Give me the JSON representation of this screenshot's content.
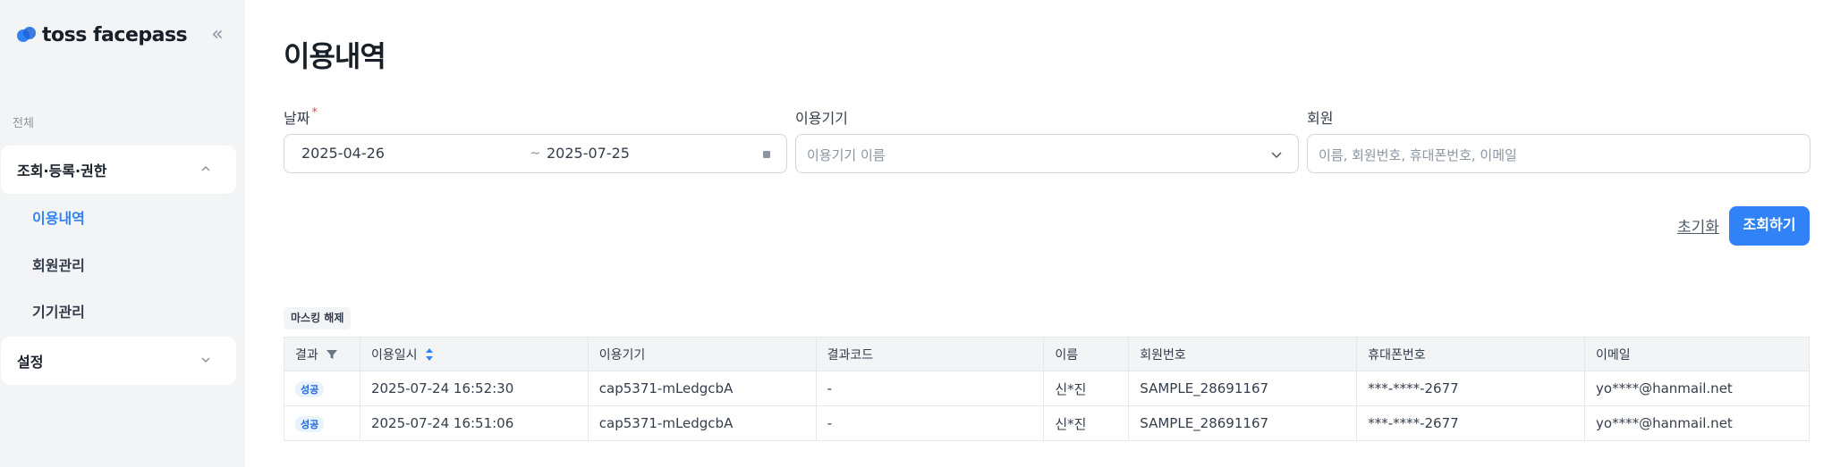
{
  "app": {
    "logo_text": "toss facepass",
    "collapse_glyph": "«"
  },
  "sidebar": {
    "section_label": "전체",
    "groups": [
      {
        "label": "조회·등록·권한",
        "expanded": true
      },
      {
        "label": "설정",
        "expanded": false
      }
    ],
    "items": [
      {
        "label": "이용내역",
        "active": true
      },
      {
        "label": "회원관리",
        "active": false
      },
      {
        "label": "기기관리",
        "active": false
      }
    ]
  },
  "page": {
    "title": "이용내역"
  },
  "filters": {
    "date": {
      "label": "날짜",
      "required_mark": "*",
      "start": "2025-04-26",
      "separator": "~",
      "end": "2025-07-25"
    },
    "device": {
      "label": "이용기기",
      "placeholder": "이용기기 이름"
    },
    "member": {
      "label": "회원",
      "placeholder": "이름, 회원번호, 휴대폰번호, 이메일"
    },
    "reset_label": "초기화",
    "search_label": "조회하기"
  },
  "table": {
    "mask_toggle_label": "마스킹 해제",
    "columns": [
      "결과",
      "이용일시",
      "이용기기",
      "결과코드",
      "이름",
      "회원번호",
      "휴대폰번호",
      "이메일"
    ],
    "rows": [
      {
        "result": "성공",
        "datetime": "2025-07-24 16:52:30",
        "device": "cap5371-mLedgcbA",
        "code": "-",
        "name": "신*진",
        "member_no": "SAMPLE_28691167",
        "phone": "***-****-2677",
        "email": "yo****@hanmail.net"
      },
      {
        "result": "성공",
        "datetime": "2025-07-24 16:51:06",
        "device": "cap5371-mLedgcbA",
        "code": "-",
        "name": "신*진",
        "member_no": "SAMPLE_28691167",
        "phone": "***-****-2677",
        "email": "yo****@hanmail.net"
      }
    ]
  },
  "colors": {
    "accent": "#3182f6",
    "sidebar_bg": "#f2f4f6",
    "success_badge_bg": "#e8f3ff",
    "success_badge_text": "#1b64da",
    "required": "#f04452"
  }
}
